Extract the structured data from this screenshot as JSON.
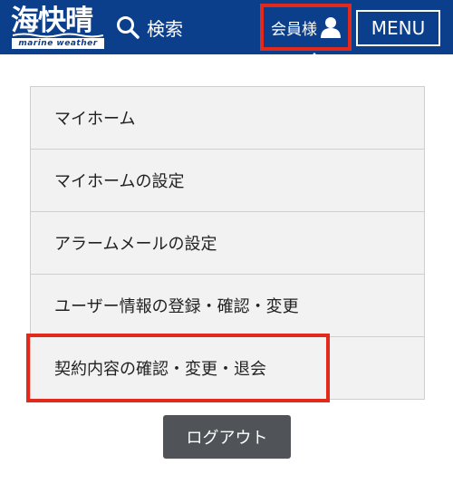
{
  "header": {
    "logo": {
      "main": "海快晴",
      "sub": "marine weather",
      "icon": "wave-logo"
    },
    "search": {
      "label": "検索",
      "icon": "search-icon"
    },
    "member": {
      "label": "会員様",
      "icon": "user-icon"
    },
    "menu_button": "MENU"
  },
  "menu": {
    "items": [
      {
        "label": "マイホーム"
      },
      {
        "label": "マイホームの設定"
      },
      {
        "label": "アラームメールの設定"
      },
      {
        "label": "ユーザー情報の登録・確認・変更"
      },
      {
        "label": "契約内容の確認・変更・退会"
      }
    ],
    "logout": "ログアウト"
  },
  "colors": {
    "header_bg": "#0b3f8c",
    "highlight": "#e12a1c",
    "menu_bg": "#f2f2f2",
    "logout_bg": "#505459"
  }
}
